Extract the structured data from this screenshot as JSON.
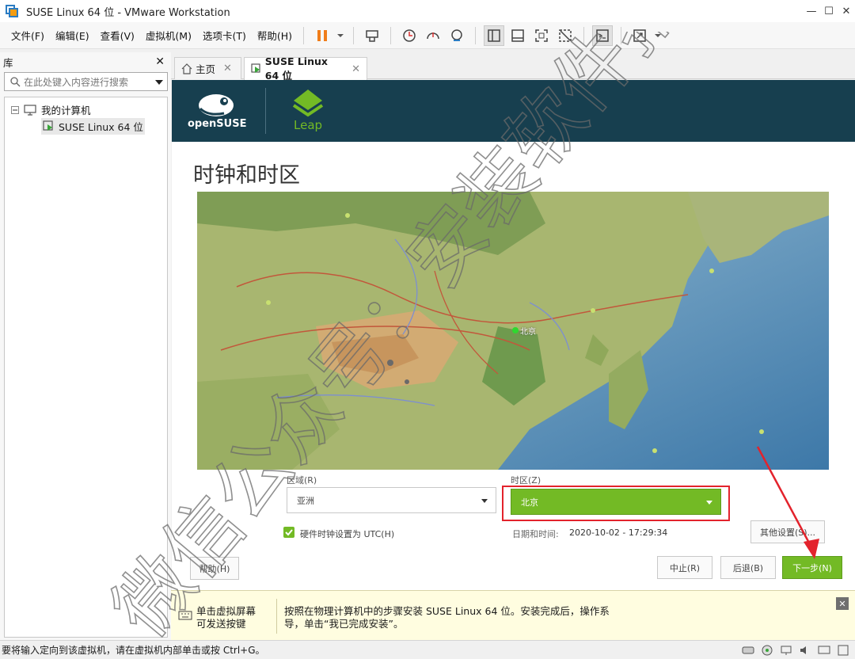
{
  "window": {
    "title": "SUSE Linux 64 位 - VMware Workstation"
  },
  "menu": [
    "文件(F)",
    "编辑(E)",
    "查看(V)",
    "虚拟机(M)",
    "选项卡(T)",
    "帮助(H)"
  ],
  "library": {
    "title": "库",
    "search_placeholder": "在此处键入内容进行搜索",
    "tree": {
      "root": "我的计算机",
      "vm": "SUSE Linux 64 位"
    }
  },
  "tabs": [
    {
      "label": "主页"
    },
    {
      "label": "SUSE Linux 64 位"
    }
  ],
  "vm": {
    "brand": {
      "opensuse": "openSUSE",
      "leap": "Leap"
    },
    "heading": "时钟和时区",
    "map_city": "北京",
    "region": {
      "label": "区域(R)",
      "value": "亚洲"
    },
    "timezone": {
      "label": "时区(Z)",
      "value": "北京"
    },
    "utc_checkbox": {
      "label": "硬件时钟设置为 UTC(H)",
      "checked": true
    },
    "datetime": {
      "label": "日期和时间:",
      "value": "2020-10-02 - 17:29:34"
    },
    "buttons": {
      "other_settings": "其他设置(S)...",
      "help": "帮助(H)",
      "abort": "中止(R)",
      "back": "后退(B)",
      "next": "下一步(N)"
    },
    "colors": {
      "header": "#173f4f",
      "accent_green": "#73ba25",
      "highlight_red": "#e3232c"
    }
  },
  "hint": {
    "left": "单击虚拟屏幕\n可发送按键",
    "text": "按照在物理计算机中的步骤安装 SUSE Linux 64 位。安装完成后，操作系\n导，单击“我已完成安装”。"
  },
  "status": {
    "message": "要将输入定向到该虚拟机，请在虚拟机内部单击或按 Ctrl+G。"
  },
  "watermark": "微信公众号：安装软件指南"
}
